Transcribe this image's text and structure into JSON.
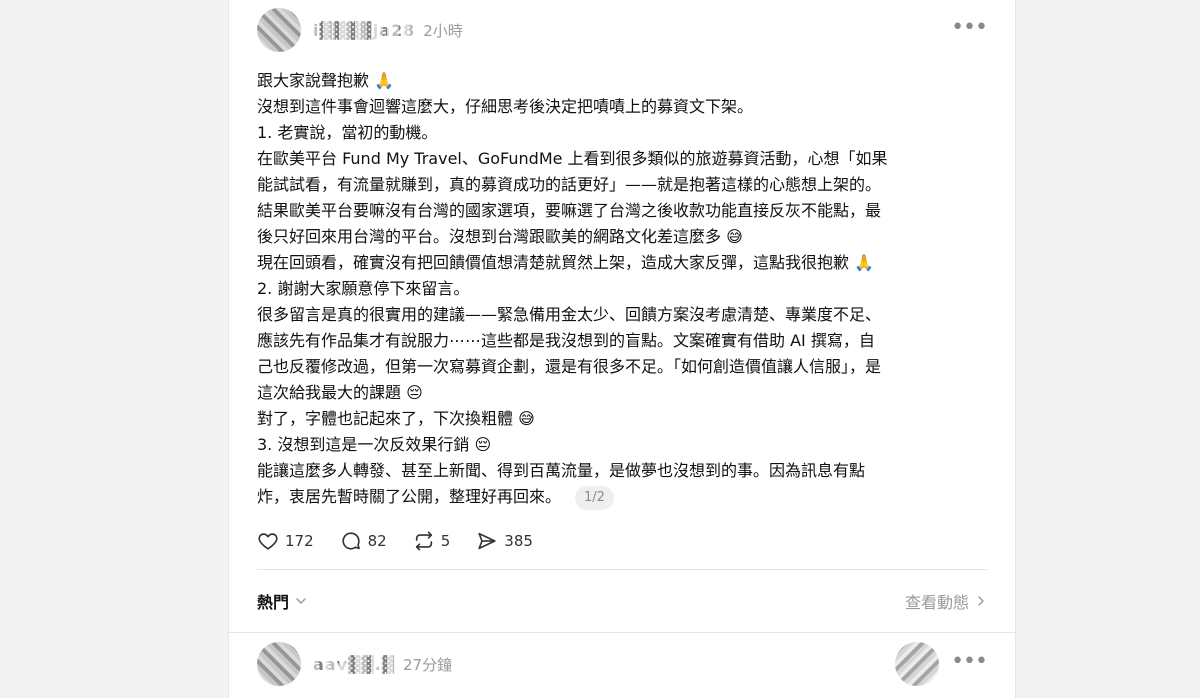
{
  "post": {
    "username": "i▓▓▓▓ja28",
    "timestamp": "2小時",
    "more_label": "•••",
    "lines": [
      "跟大家說聲抱歉 🙏",
      "沒想到這件事會迴響這麼大，仔細思考後決定把嘖嘖上的募資文下架。",
      "1. 老實說，當初的動機。",
      "在歐美平台 Fund My Travel、GoFundMe 上看到很多類似的旅遊募資活動，心想「如果",
      "能試試看，有流量就賺到，真的募資成功的話更好」——就是抱著這樣的心態想上架的。",
      "結果歐美平台要嘛沒有台灣的國家選項，要嘛選了台灣之後收款功能直接反灰不能點，最",
      "後只好回來用台灣的平台。沒想到台灣跟歐美的網路文化差這麼多 😅",
      "現在回頭看，確實沒有把回饋價值想清楚就貿然上架，造成大家反彈，這點我很抱歉 🙏",
      "2. 謝謝大家願意停下來留言。",
      "很多留言是真的很實用的建議——緊急備用金太少、回饋方案沒考慮清楚、專業度不足、",
      "應該先有作品集才有說服力⋯⋯這些都是我沒想到的盲點。文案確實有借助 AI 撰寫，自",
      "己也反覆修改過，但第一次寫募資企劃，還是有很多不足。「如何創造價值讓人信服」，是",
      "這次給我最大的課題 😔",
      "對了，字體也記起來了，下次換粗體 😅",
      "3. 沒想到這是一次反效果行銷 😔",
      "能讓這麼多人轉發、甚至上新聞、得到百萬流量，是做夢也沒想到的事。因為訊息有點"
    ],
    "last_line": "炸，衷居先暫時關了公開，整理好再回來。",
    "page_indicator": "1/2"
  },
  "actions": {
    "likes": "172",
    "comments": "82",
    "reposts": "5",
    "shares": "385"
  },
  "sort": {
    "label": "熱門",
    "view_activity": "查看動態"
  },
  "reply": {
    "username": "aav▓▓.▓",
    "timestamp": "27分鐘"
  },
  "colors": {
    "text": "#111111",
    "muted": "#9b9b9b",
    "background": "#f3f3f3",
    "card": "#ffffff"
  }
}
